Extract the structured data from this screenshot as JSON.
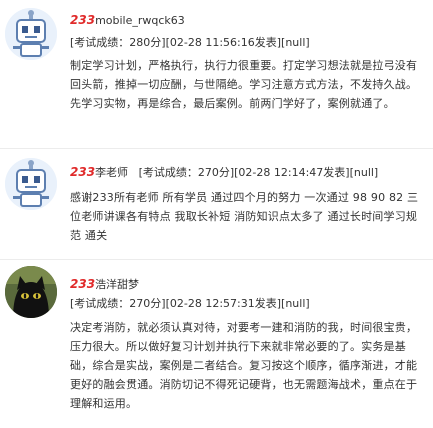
{
  "posts": [
    {
      "prefix": "233",
      "username": "mobile_rwqck63",
      "score_line": "[考试成绩：280分][02-28 11:56:16发表][null]",
      "content": "制定学习计划，严格执行，执行力很重要。打定学习想法就是拉弓没有回头箭，推掉一切应酬，与世隔绝。学习注意方式方法，不发持久战。先学习实物，再是综合，最后案例。前两门学好了，案例就通了。",
      "avatar_icon": "robot-avatar-icon"
    },
    {
      "prefix": "233",
      "username": "李老师",
      "score_line": "[考试成绩：270分][02-28 12:14:47发表][null]",
      "content": "感谢233所有老师 所有学员 通过四个月的努力 一次通过 98 90 82 三位老师讲课各有特点 我取长补短 消防知识点太多了 通过长时间学习规范 通关",
      "avatar_icon": "robot-avatar-icon"
    },
    {
      "prefix": "233",
      "username": "浩洋甜梦",
      "score_line": "[考试成绩：270分][02-28 12:57:31发表][null]",
      "content": "决定考消防，就必须认真对待，对要考一建和消防的我，时间很宝贵，压力很大。所以做好复习计划并执行下来就非常必要的了。实务是基础，综合是实战，案例是二者结合。复习按这个顺序，循序渐进，才能更好的融会贯通。消防切记不得死记硬背，也无需题海战术，重点在于理解和运用。",
      "avatar_icon": "black-cat-avatar-icon"
    }
  ],
  "colors": {
    "prefix": "#e02a2a",
    "text": "#333333",
    "divider": "#ececec"
  }
}
